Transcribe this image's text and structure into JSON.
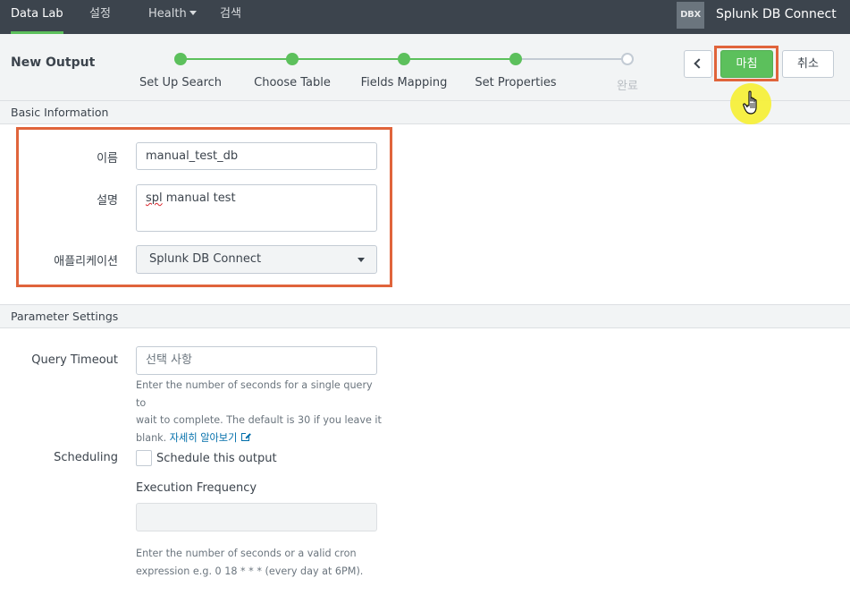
{
  "nav": {
    "items": [
      {
        "label": "Data Lab",
        "active": true
      },
      {
        "label": "설정"
      },
      {
        "label": "Health"
      },
      {
        "label": "검색"
      }
    ],
    "logo_text": "DBX",
    "app_name": "Splunk DB Connect"
  },
  "wizard": {
    "title": "New Output",
    "steps": [
      {
        "label": "Set Up Search",
        "state": "complete"
      },
      {
        "label": "Choose Table",
        "state": "complete"
      },
      {
        "label": "Fields Mapping",
        "state": "complete"
      },
      {
        "label": "Set Properties",
        "state": "current"
      },
      {
        "label": "완료",
        "state": "pending"
      }
    ],
    "finish_label": "마침",
    "cancel_label": "취소",
    "back_icon": "chevron-left-icon",
    "accent_color": "#5cc05c",
    "highlight_color": "#e0643b"
  },
  "basic": {
    "header": "Basic Information",
    "name_label": "이름",
    "name_value": "manual_test_db",
    "desc_label": "설명",
    "desc_word1": "spl",
    "desc_rest": " manual test",
    "app_label": "애플리케이션",
    "app_value": "Splunk DB Connect"
  },
  "params": {
    "header": "Parameter Settings",
    "timeout_label": "Query Timeout",
    "timeout_placeholder": "선택 사항",
    "timeout_help_1": "Enter the number of seconds for a single query to",
    "timeout_help_2": "wait to complete. The default is 30 if you leave it",
    "timeout_help_3": "blank.",
    "learn_more": "자세히 알아보기",
    "scheduling_label": "Scheduling",
    "schedule_checkbox_label": "Schedule this output",
    "exec_freq_label": "Execution Frequency",
    "exec_help_1": "Enter the number of seconds or a valid cron",
    "exec_help_2": "expression e.g. 0 18 * * * (every day at 6PM)."
  }
}
